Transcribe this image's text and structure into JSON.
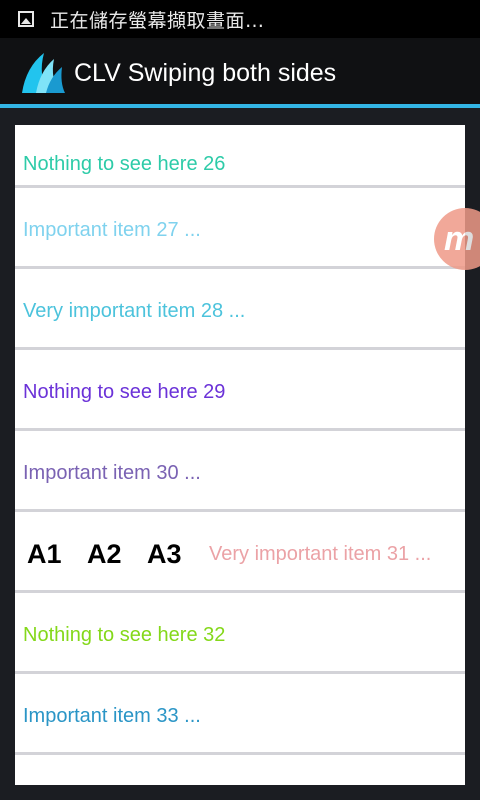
{
  "status_bar": {
    "notification_icon": "image-icon",
    "text": "正在儲存螢幕擷取畫面…"
  },
  "action_bar": {
    "app_icon": "water-drops-logo",
    "title": "CLV Swiping both sides"
  },
  "list": {
    "items": [
      {
        "label": "Nothing to see here 26",
        "color": "#2dcba8"
      },
      {
        "label": "Important item 27 ...",
        "color": "#7fd2ee"
      },
      {
        "label": "Very important item 28 ...",
        "color": "#4cc3dc"
      },
      {
        "label": "Nothing to see here 29",
        "color": "#6b32d8"
      },
      {
        "label": "Important item 30 ...",
        "color": "#7a62b3"
      },
      {
        "label": "Very important item 31 ...",
        "color": "#eba2a6",
        "actions": [
          "A1",
          "A2",
          "A3"
        ]
      },
      {
        "label": "Nothing to see here 32",
        "color": "#84d81a"
      },
      {
        "label": "Important item 33 ...",
        "color": "#2a95c6"
      },
      {
        "label": "",
        "color": "#000000"
      }
    ]
  },
  "floating_badge": {
    "icon": "m-logo",
    "letter": "m"
  }
}
